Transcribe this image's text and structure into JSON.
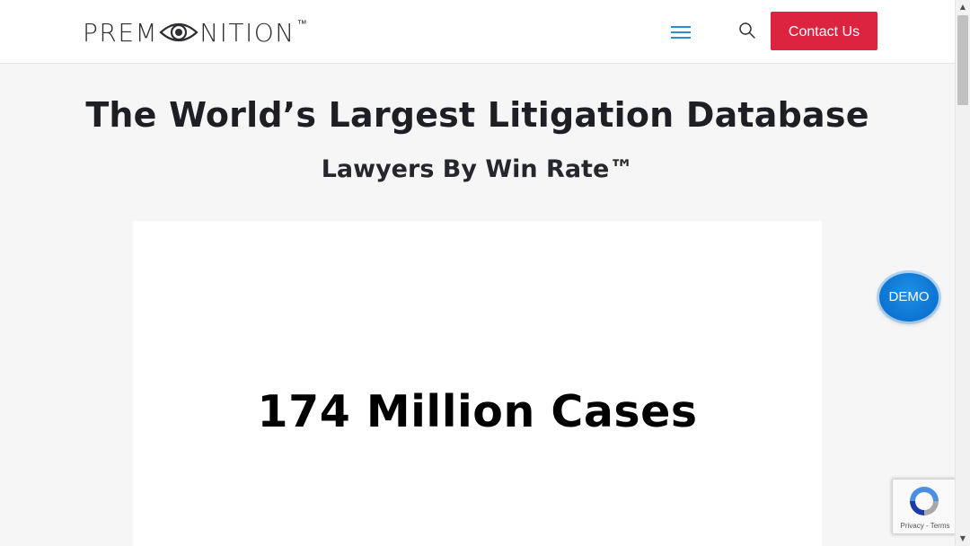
{
  "header": {
    "logo": {
      "text_before": "PREM",
      "text_after": "NITION",
      "trademark": "™",
      "eye_icon": "eye-icon"
    },
    "menu_icon": "hamburger-menu-icon",
    "search_icon": "search-icon",
    "contact_label": "Contact Us"
  },
  "hero": {
    "title": "The World’s Largest Litigation Database",
    "subtitle": "Lawyers By Win Rate™"
  },
  "feature": {
    "text": "174 Million Cases"
  },
  "demo_button": {
    "label": "DEMO"
  },
  "recaptcha": {
    "icon": "recaptcha-icon",
    "privacy": "Privacy",
    "separator": "-",
    "terms": "Terms"
  },
  "colors": {
    "accent_red": "#dc2340",
    "accent_blue": "#2b8fd4",
    "demo_blue": "#0b74d1",
    "heading": "#1e1f24",
    "background": "#f6f6f6"
  }
}
